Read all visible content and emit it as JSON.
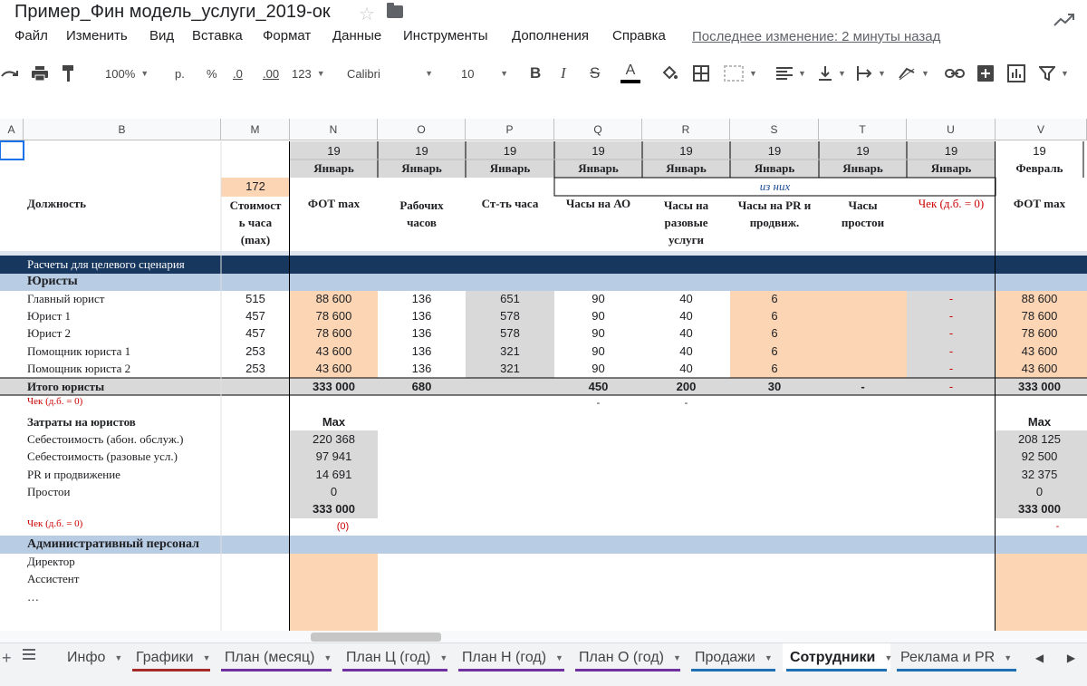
{
  "doc": {
    "title": "Пример_Фин модель_услуги_2019-ок",
    "last_edit": "Последнее изменение: 2 минуты назад"
  },
  "menu": [
    "Файл",
    "Изменить",
    "Вид",
    "Вставка",
    "Формат",
    "Данные",
    "Инструменты",
    "Дополнения",
    "Справка"
  ],
  "toolbar": {
    "zoom": "100%",
    "currency": "р.",
    "percent": "%",
    "dec_less": ".0",
    "dec_more": ".00",
    "format": "123",
    "font": "Calibri",
    "font_size": "10",
    "bold": "B",
    "italic": "I",
    "strike": "S",
    "text_color": "A"
  },
  "columns": [
    "A",
    "B",
    "M",
    "N",
    "O",
    "P",
    "Q",
    "R",
    "S",
    "T",
    "U",
    "V"
  ],
  "header": {
    "year": "19",
    "month_jan": "Январь",
    "month_feb": "Февраль",
    "m_value": "172",
    "iz_nih": "из них",
    "position": "Должность",
    "cost_hour": [
      "Стоимост",
      "ь часа",
      "(max)"
    ],
    "fot": "ФОТ max",
    "work_hours": [
      "Рабочих",
      "часов"
    ],
    "hour_cost": "Ст-ть часа",
    "hours_ao": "Часы на АО",
    "hours_once": [
      "Часы на",
      "разовые",
      "услуги"
    ],
    "hours_pr": [
      "Часы на PR и",
      "продвиж."
    ],
    "hours_idle": [
      "Часы",
      "простои"
    ],
    "check": "Чек (д.б. = 0)"
  },
  "sections": {
    "target": "Расчеты для целевого сценария",
    "lawyers": "Юристы",
    "admin": "Административный персонал"
  },
  "rows": [
    {
      "name": "Главный юрист",
      "m": "515",
      "n": "88 600",
      "o": "136",
      "p": "651",
      "q": "90",
      "r": "40",
      "s": "6",
      "u": "-",
      "v": "88 600"
    },
    {
      "name": "Юрист 1",
      "m": "457",
      "n": "78 600",
      "o": "136",
      "p": "578",
      "q": "90",
      "r": "40",
      "s": "6",
      "u": "-",
      "v": "78 600"
    },
    {
      "name": "Юрист 2",
      "m": "457",
      "n": "78 600",
      "o": "136",
      "p": "578",
      "q": "90",
      "r": "40",
      "s": "6",
      "u": "-",
      "v": "78 600"
    },
    {
      "name": "Помощник юриста 1",
      "m": "253",
      "n": "43 600",
      "o": "136",
      "p": "321",
      "q": "90",
      "r": "40",
      "s": "6",
      "u": "-",
      "v": "43 600"
    },
    {
      "name": "Помощник юриста 2",
      "m": "253",
      "n": "43 600",
      "o": "136",
      "p": "321",
      "q": "90",
      "r": "40",
      "s": "6",
      "u": "-",
      "v": "43 600"
    }
  ],
  "total": {
    "name": "Итого юристы",
    "n": "333 000",
    "o": "680",
    "q": "450",
    "r": "200",
    "s": "30",
    "t": "-",
    "u": "-",
    "v": "333 000"
  },
  "check_row": {
    "label": "Чек (д.б. = 0)",
    "q": "-",
    "r": "-"
  },
  "costs": {
    "title": "Затраты на юристов",
    "max": "Max",
    "items": [
      {
        "name": "Себестоимость (абон. обслуж.)",
        "n": "220 368",
        "v": "208 125"
      },
      {
        "name": "Себестоимость (разовые усл.)",
        "n": "97 941",
        "v": "92 500"
      },
      {
        "name": "PR и продвижение",
        "n": "14 691",
        "v": "32 375"
      },
      {
        "name": "Простои",
        "n": "0",
        "v": "0"
      }
    ],
    "sum_n": "333 000",
    "sum_v": "333 000",
    "check_label": "Чек (д.б. = 0)",
    "check_n": "(0)",
    "check_v": "-"
  },
  "admin_rows": [
    "Директор",
    "Ассистент",
    "…"
  ],
  "sheets": [
    {
      "label": "Инфо",
      "color": ""
    },
    {
      "label": "Графики",
      "color": "#a52a2a"
    },
    {
      "label": "План (месяц)",
      "color": "#7030a0"
    },
    {
      "label": "План Ц (год)",
      "color": "#7030a0"
    },
    {
      "label": "План Н (год)",
      "color": "#7030a0"
    },
    {
      "label": "План О (год)",
      "color": "#7030a0"
    },
    {
      "label": "Продажи",
      "color": "#1f6fb5"
    },
    {
      "label": "Сотрудники",
      "color": "#1f6fb5",
      "active": true
    },
    {
      "label": "Реклама и PR",
      "color": "#1f6fb5"
    }
  ],
  "colors": {
    "peach": "#fcd5b4",
    "gray": "#d9d9d9",
    "navy": "#17375e",
    "blue_band": "#b8cce4",
    "red": "#cc0000"
  }
}
